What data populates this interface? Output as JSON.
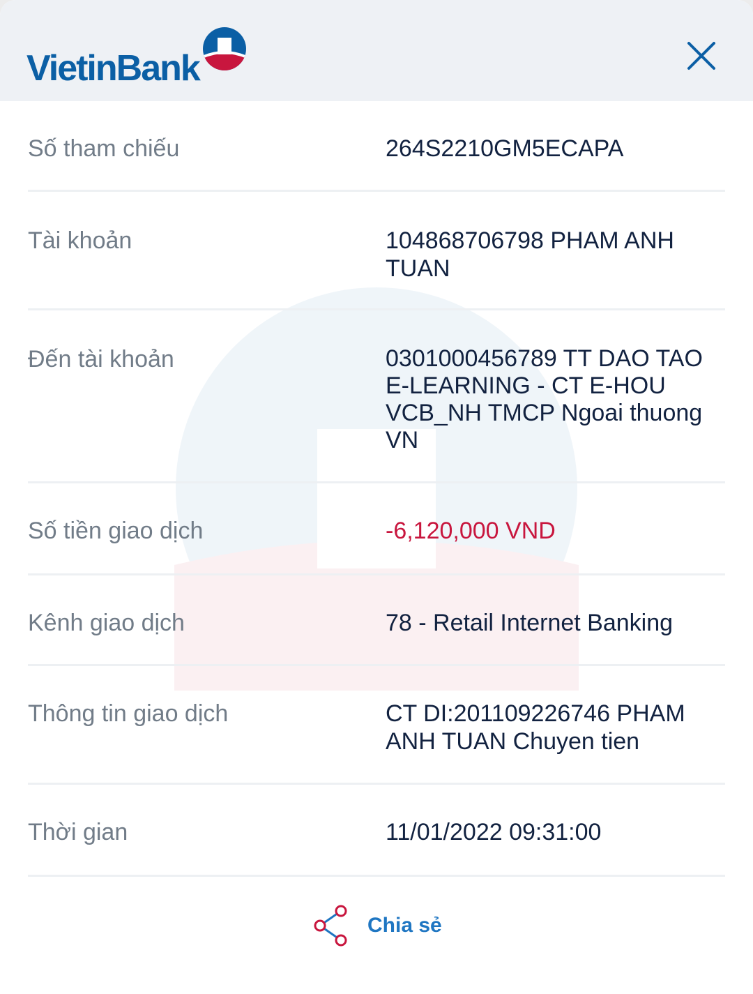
{
  "header": {
    "brand": "VietinBank"
  },
  "details": [
    {
      "label": "Số tham chiếu",
      "value": "264S2210GM5ECAPA"
    },
    {
      "label": "Tài khoản",
      "value": "104868706798 PHAM ANH TUAN"
    },
    {
      "label": "Đến tài khoản",
      "value": "0301000456789 TT DAO TAO E-LEARNING - CT E-HOU VCB_NH TMCP Ngoai thuong VN"
    },
    {
      "label": "Số tiền giao dịch",
      "value": "-6,120,000 VND"
    },
    {
      "label": "Kênh giao dịch",
      "value": "78 - Retail Internet Banking"
    },
    {
      "label": "Thông tin giao dịch",
      "value": "CT DI:201109226746 PHAM ANH TUAN Chuyen tien"
    },
    {
      "label": "Thời gian",
      "value": "11/01/2022 09:31:00"
    }
  ],
  "share": {
    "label": "Chia sẻ"
  },
  "colors": {
    "brand_blue": "#0b5fa5",
    "brand_red": "#c8163e",
    "label_gray": "#717c88",
    "value_navy": "#122240",
    "link_blue": "#1f76c2"
  },
  "icons": {
    "close": "close-icon",
    "share": "share-icon",
    "logo": "vietinbank-logo-mark"
  }
}
